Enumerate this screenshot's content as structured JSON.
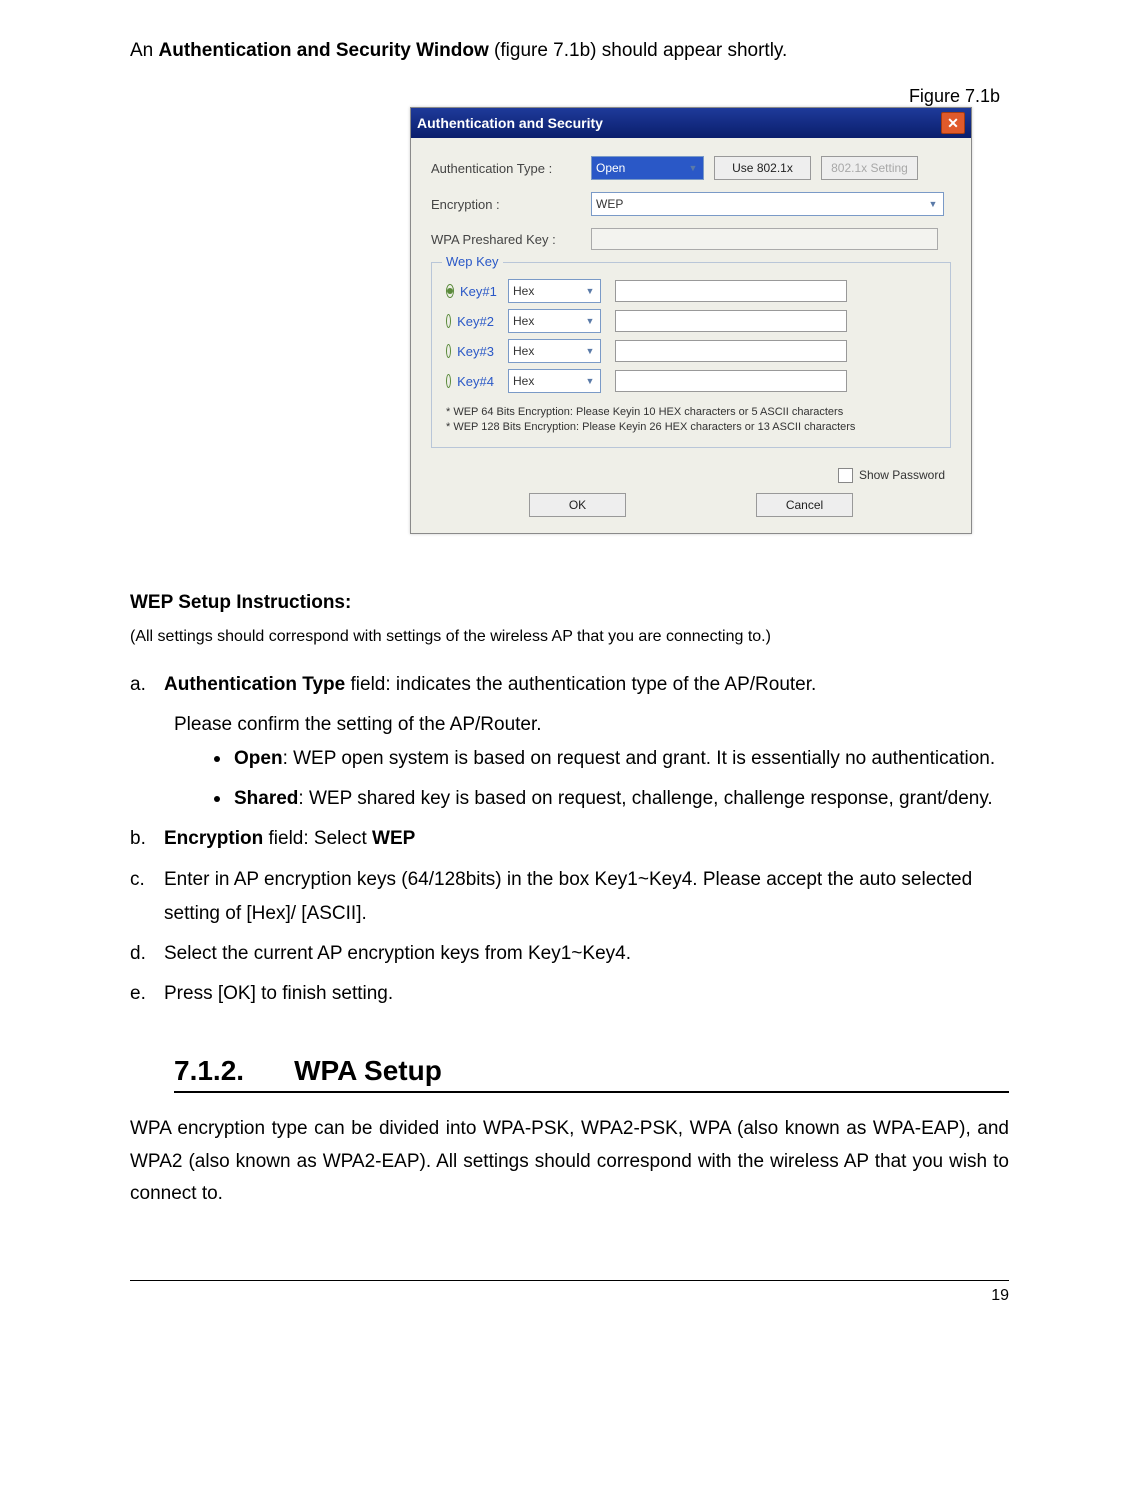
{
  "intro_pre": "An ",
  "intro_bold": "Authentication and Security Window",
  "intro_post": " (figure 7.1b) should appear shortly.",
  "figure_label": "Figure 7.1b",
  "dialog": {
    "title": "Authentication and Security",
    "close": "✕",
    "auth_label": "Authentication Type :",
    "auth_value": "Open",
    "use8021x": "Use 802.1x",
    "setting8021x": "802.1x Setting",
    "enc_label": "Encryption :",
    "enc_value": "WEP",
    "wpa_label": "WPA Preshared Key :",
    "legend": "Wep Key",
    "hex": "Hex",
    "key1": "Key#1",
    "key2": "Key#2",
    "key3": "Key#3",
    "key4": "Key#4",
    "note1": "* WEP 64 Bits Encryption:  Please Keyin 10 HEX characters or 5 ASCII characters",
    "note2": "* WEP 128 Bits Encryption:  Please Keyin 26 HEX characters or 13 ASCII characters",
    "showpw": "Show Password",
    "ok": "OK",
    "cancel": "Cancel"
  },
  "wep_heading": "WEP Setup Instructions:",
  "wep_note": "(All settings should correspond with settings of the wireless AP that you are connecting to.)",
  "a": {
    "lt": "a.",
    "b": "Authentication Type",
    "t": " field: indicates the authentication type of the AP/Router.",
    "sub": "Please confirm the setting of the AP/Router.",
    "open_b": "Open",
    "open_t": ": WEP open system is based on request and grant. It is essentially no authentication.",
    "shared_b": "Shared",
    "shared_t": ": WEP shared key is based on request, challenge, challenge response, grant/deny."
  },
  "b": {
    "lt": "b.",
    "b": "Encryption",
    "t": " field:  Select ",
    "b2": "WEP"
  },
  "c": {
    "lt": "c.",
    "t": "Enter in AP encryption keys (64/128bits) in the box Key1~Key4.  Please accept the auto selected setting of [Hex]/ [ASCII]."
  },
  "d": {
    "lt": "d.",
    "t": "Select the current AP encryption keys from Key1~Key4."
  },
  "e": {
    "lt": "e.",
    "t": "Press [OK] to finish setting."
  },
  "h2_num": "7.1.2.",
  "h2_txt": "WPA Setup",
  "wpa_para": "WPA encryption type can be divided into WPA-PSK, WPA2-PSK, WPA (also known as WPA-EAP), and WPA2 (also known as WPA2-EAP). All settings should correspond with the wireless AP that you wish to connect to.",
  "page_number": "19"
}
